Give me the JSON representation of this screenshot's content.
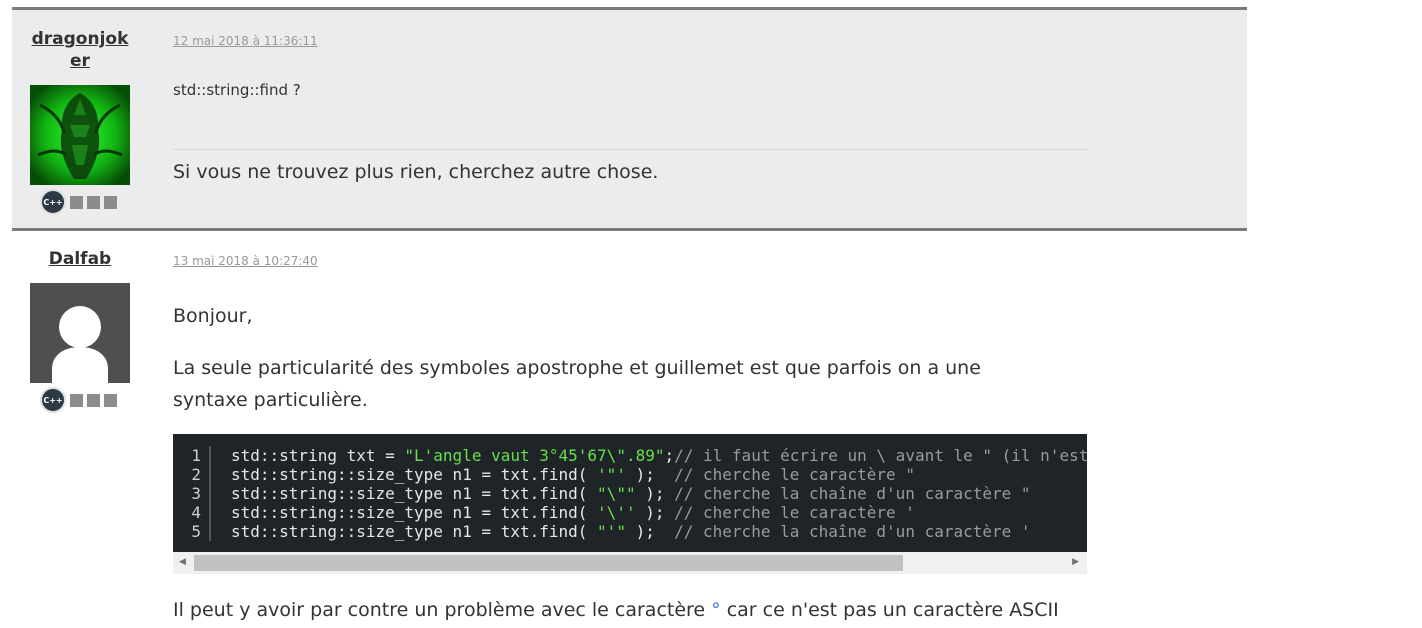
{
  "posts": [
    {
      "author": "dragonjoker",
      "date": "12 mai 2018 à 11:36:11",
      "body": "std::string::find ?",
      "signature": "Si vous ne trouvez plus rien, cherchez autre chose.",
      "badge": "C++",
      "avatar_icon": "green-dragon-avatar"
    },
    {
      "author": "Dalfab",
      "date": "13 mai 2018 à 10:27:40",
      "greeting": "Bonjour,",
      "paragraph": "La seule particularité des symboles apostrophe et guillemet est que parfois on a une syntaxe particulière.",
      "badge": "C++",
      "avatar_icon": "default-user-avatar",
      "code": {
        "line_numbers": [
          "1",
          "2",
          "3",
          "4",
          "5"
        ],
        "lines": [
          {
            "pre": "std::string txt = ",
            "str": "\"L'angle vaut 3°45'67\\\".89\"",
            "mid": ";",
            "com": "// il faut écrire un \\ avant le \" (il n'est"
          },
          {
            "pre": "std::string::size_type n1 = txt.find( ",
            "str": "'\"'",
            "mid": " );  ",
            "com": "// cherche le caractère \""
          },
          {
            "pre": "std::string::size_type n1 = txt.find( ",
            "str": "\"\\\"\"",
            "mid": " ); ",
            "com": "// cherche la chaîne d'un caractère \""
          },
          {
            "pre": "std::string::size_type n1 = txt.find( ",
            "str": "'\\''",
            "mid": " ); ",
            "com": "// cherche le caractère '"
          },
          {
            "pre": "std::string::size_type n1 = txt.find( ",
            "str": "\"'\"",
            "mid": " );  ",
            "com": "// cherche la chaîne d'un caractère '"
          }
        ]
      },
      "bottom_pre": "Il peut y avoir par contre un problème avec le caractère ",
      "bottom_degree": "°",
      "bottom_post": " car ce n'est pas un caractère ASCII"
    }
  ],
  "colors": {
    "string": "#66e048",
    "comment": "#9a9a9a",
    "code_bg": "#1f2428",
    "link_blue": "#3878d0"
  }
}
